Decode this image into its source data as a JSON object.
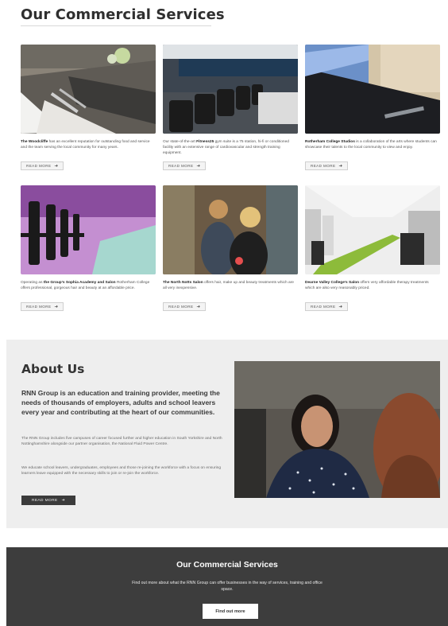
{
  "page_title": "Our Commercial Services",
  "cards": [
    {
      "name_bold": "The Woodcliffe",
      "text": " has an excellent reputation for outstanding food and service and the team serving the local community for many years.",
      "button": "READ MORE",
      "image_icon": "restaurant-table-image"
    },
    {
      "name_bold": "",
      "text": "Our state-of-the-art ",
      "name_bold2": "Fitness25",
      "text2": " gym suite is a 75 station, hi-fi or conditioned facility with an extensive range of cardiovascular and strength training equipment.",
      "button": "READ MORE",
      "image_icon": "gym-equipment-image"
    },
    {
      "name_bold": "Rotherham College Studios",
      "text": " is a collaboration of the arts where students can showcase their talents to the local community to view and enjoy.",
      "button": "READ MORE",
      "image_icon": "studios-sign-image"
    },
    {
      "name_bold": "",
      "text": "Operating as ",
      "name_bold2": "the Group's Sophia Academy and Salon",
      "text2": " Rotherham College offers professional, gorgeous hair and beauty at an affordable price.",
      "button": "READ MORE",
      "image_icon": "pink-gym-image"
    },
    {
      "name_bold": "The North Notts Salon",
      "text": " offers hair, make up and beauty treatments which are all very inexpensive.",
      "button": "READ MORE",
      "image_icon": "salon-students-image"
    },
    {
      "name_bold": "Dearne Valley College's Salon",
      "text": " offers very affordable therapy treatments which are also very reasonably priced.",
      "button": "READ MORE",
      "image_icon": "salon-interior-image"
    }
  ],
  "about": {
    "title": "About Us",
    "lead": "RNN Group is an education and training provider, meeting the needs of thousands of employers, adults and school leavers every year and contributing at the heart of our communities.",
    "p1": "The RNN Group includes five campuses of career focused further and higher education in South Yorkshire and North Nottinghamshire alongside our partner organisation, the National Fluid Power Centre.",
    "p2": "We educate school leavers, undergraduates, employees and those re-joining the workforce with a focus on ensuring learners leave equipped with the necessary skills to join or re-join the workforce.",
    "button": "READ MORE",
    "image_icon": "smiling-student-image"
  },
  "footer": {
    "title": "Our Commercial Services",
    "text": "Find out more about what the RNN Group can offer businesses in the way of services, training and office space.",
    "button": "Find out more"
  },
  "arrow_glyph": "➜",
  "colors": {
    "footer_bg": "#3d3d3d",
    "about_bg": "#eeeeee",
    "button_dark": "#3b3b3b"
  }
}
